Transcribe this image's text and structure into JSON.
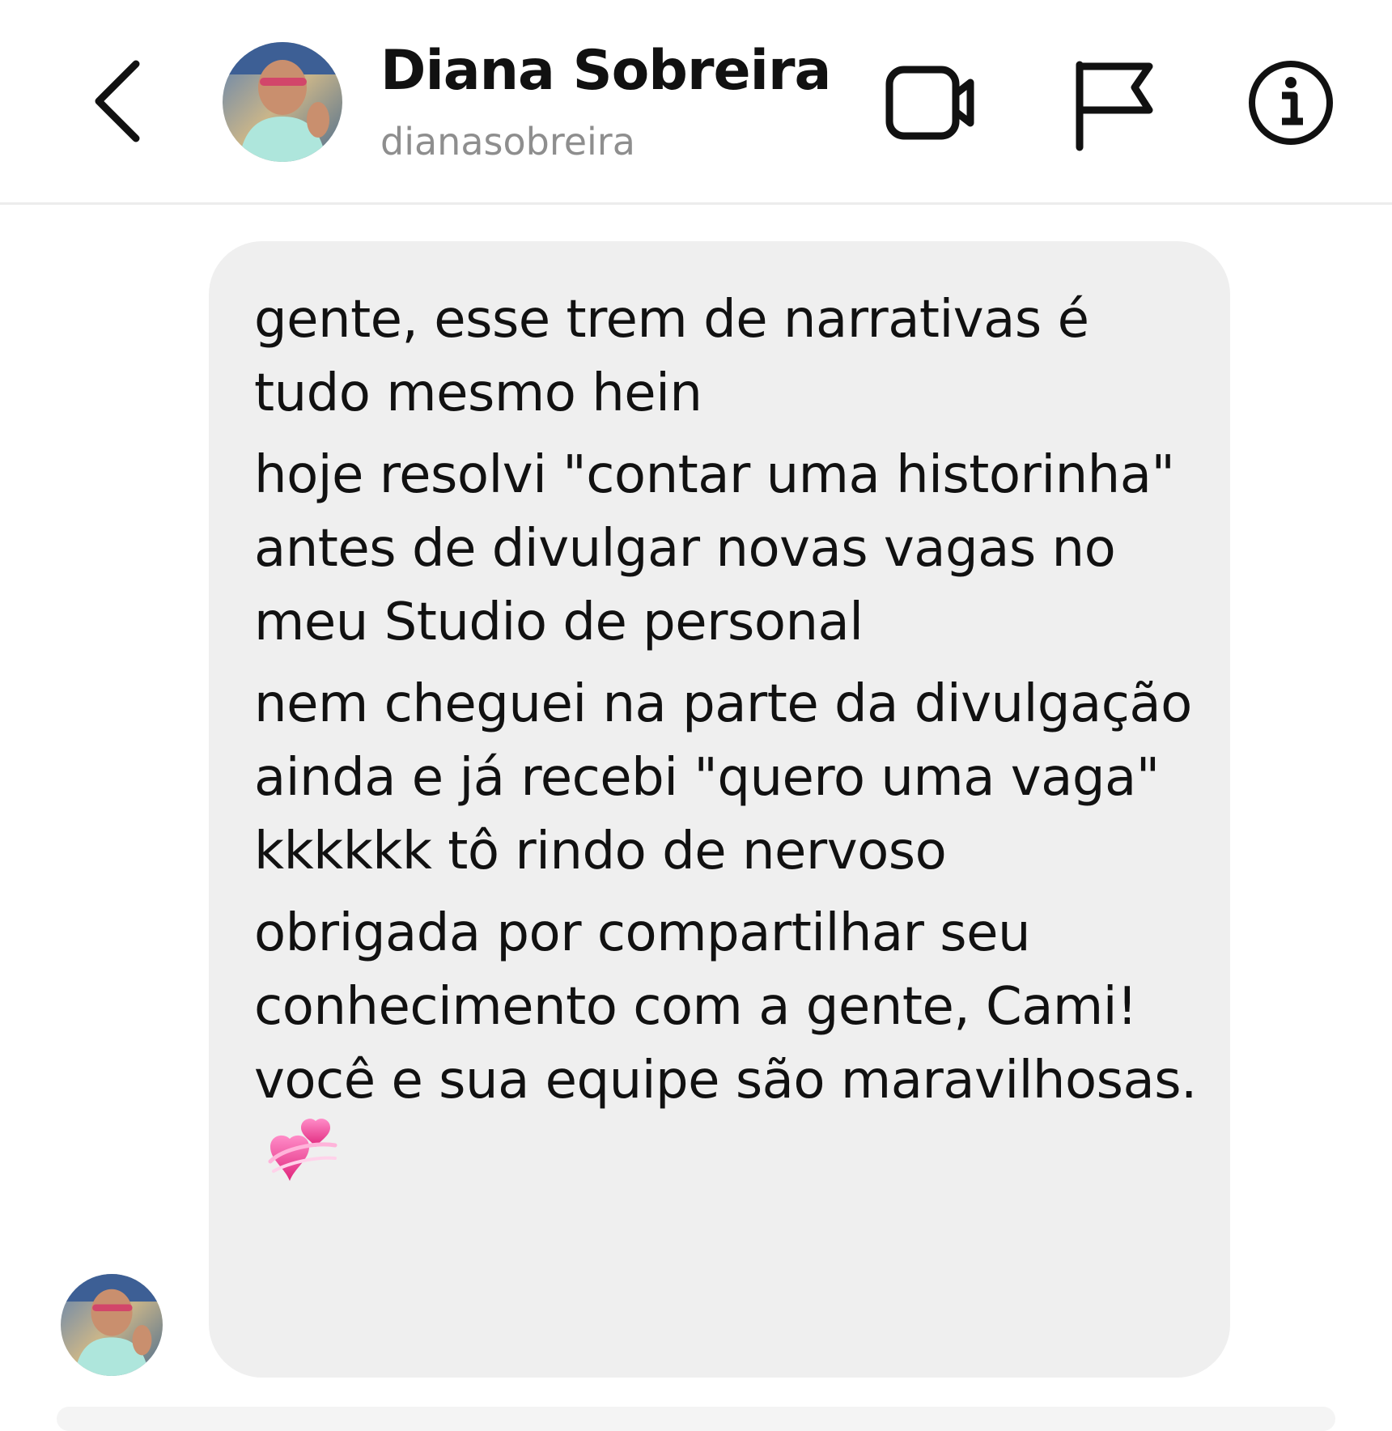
{
  "header": {
    "display_name": "Diana Sobreira",
    "username": "dianasobreira",
    "back_icon": "chevron-left-icon",
    "video_icon": "video-camera-icon",
    "flag_icon": "flag-icon",
    "info_icon": "info-icon"
  },
  "message": {
    "paragraphs": [
      "gente, esse trem de narrativas é tudo mesmo hein",
      "hoje resolvi \"contar uma historinha\" antes de divulgar novas vagas no meu Studio de personal",
      "nem cheguei na parte da divulgação ainda e já recebi \"quero uma vaga\" kkkkkk tô rindo de nervoso",
      "obrigada por compartilhar seu conhecimento com a gente, Cami! você e sua equipe são maravilhosas."
    ],
    "emoji": "two-hearts-icon"
  },
  "colors": {
    "bubble_bg": "#efefef",
    "username_gray": "#8e8e8e",
    "text": "#111111",
    "heart_pink": "#ff4fa3"
  }
}
